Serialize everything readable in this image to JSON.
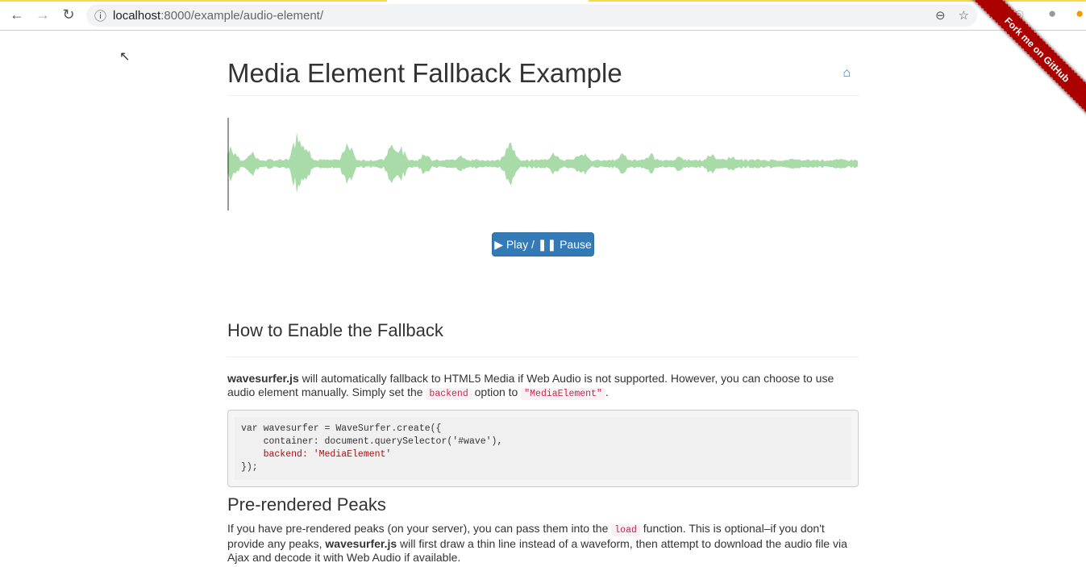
{
  "browser": {
    "url_host": "localhost",
    "url_path": ":8000/example/audio-element/",
    "back_icon": "arrow-left",
    "forward_icon": "arrow-right",
    "reload_icon": "reload"
  },
  "header": {
    "title": "Media Element Fallback Example",
    "home_icon": "home"
  },
  "player": {
    "button_label": "▶ Play / ❚❚ Pause",
    "wave_color": "#a8dba8",
    "cursor_color": "#333333"
  },
  "section1": {
    "title": "How to Enable the Fallback",
    "strong": "wavesurfer.js",
    "text1": " will automatically fallback to HTML5 Media if Web Audio is not supported. However, you can choose to use audio element manually. Simply set the ",
    "code1": "backend",
    "text2": " option to ",
    "code2": "\"MediaElement\"",
    "text3": ".",
    "code_lines": [
      "var wavesurfer = WaveSurfer.create({",
      "    container: document.querySelector('#wave'),",
      "    backend: 'MediaElement'",
      "});"
    ]
  },
  "section2": {
    "title": "Pre-rendered Peaks",
    "text1": "If you have pre-rendered peaks (on your server), you can pass them into the ",
    "code1": "load",
    "text2": " function. This is optional–if you don't provide any peaks, ",
    "strong": "wavesurfer.js",
    "text3": " will first draw a thin line instead of a waveform, then attempt to download the audio file via Ajax and decode it with Web Audio if available."
  },
  "ribbon": {
    "label": "Fork me on GitHub"
  }
}
